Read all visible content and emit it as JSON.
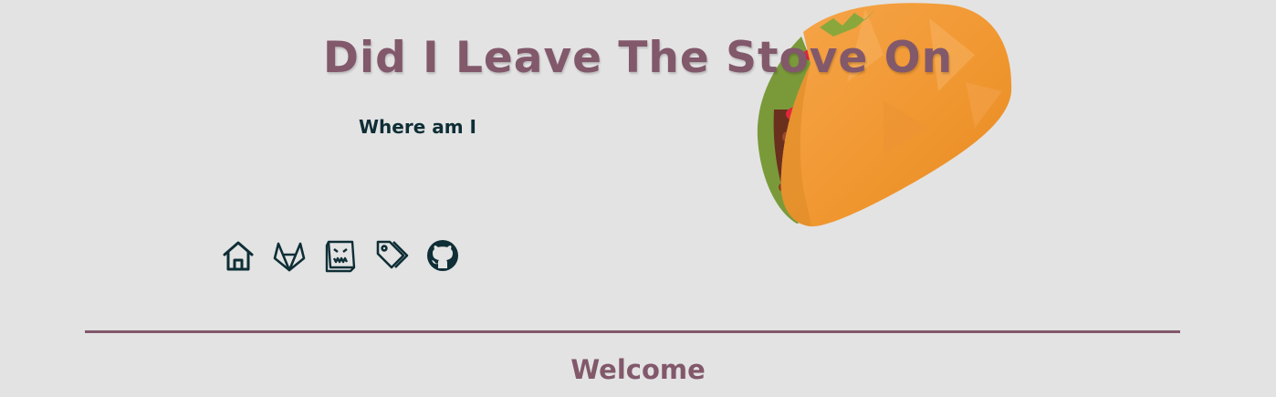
{
  "header": {
    "title": "Did I Leave The Stove On",
    "subtitle": "Where am I"
  },
  "nav_icons": [
    {
      "name": "home-icon"
    },
    {
      "name": "gitlab-icon"
    },
    {
      "name": "book-icon"
    },
    {
      "name": "tags-icon"
    },
    {
      "name": "github-icon"
    }
  ],
  "main": {
    "heading": "Welcome"
  },
  "colors": {
    "background": "#e3e3e3",
    "accent": "#82586b",
    "icon": "#0f2e36"
  }
}
